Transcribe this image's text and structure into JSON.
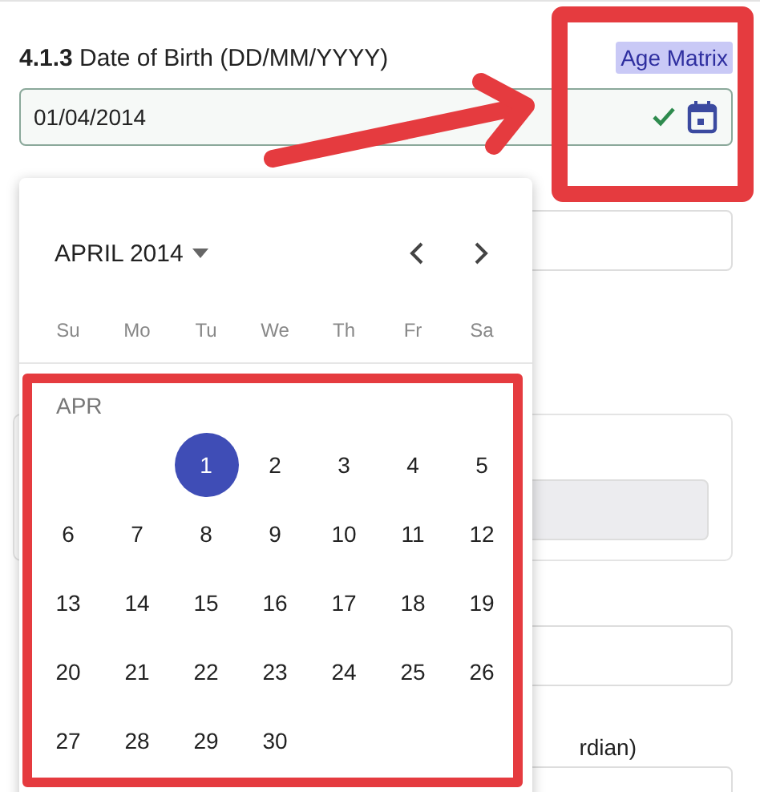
{
  "field_label": {
    "number": "4.1.3",
    "text": "Date of Birth (DD/MM/YYYY)"
  },
  "badge": "Age Matrix",
  "date_field": {
    "value": "01/04/2014",
    "valid": true
  },
  "background_label": "rdian)",
  "calendar": {
    "title": "APRIL 2014",
    "weekdays": [
      "Su",
      "Mo",
      "Tu",
      "We",
      "Th",
      "Fr",
      "Sa"
    ],
    "month_label": "APR",
    "weeks": [
      [
        {
          "kind": "blank"
        },
        {
          "kind": "blank"
        },
        {
          "kind": "day",
          "day": "1",
          "selected": true
        },
        {
          "day": "2",
          "selected": false
        },
        {
          "day": "3",
          "selected": false
        },
        {
          "day": "4",
          "selected": false
        },
        {
          "day": "5",
          "selected": false
        }
      ],
      [
        {
          "day": "6",
          "selected": false
        },
        {
          "day": "7",
          "selected": false
        },
        {
          "day": "8",
          "selected": false
        },
        {
          "day": "9",
          "selected": false
        },
        {
          "day": "10",
          "selected": false
        },
        {
          "day": "11",
          "selected": false
        },
        {
          "day": "12",
          "selected": false
        }
      ],
      [
        {
          "day": "13",
          "selected": false
        },
        {
          "day": "14",
          "selected": false
        },
        {
          "day": "15",
          "selected": false
        },
        {
          "day": "16",
          "selected": false
        },
        {
          "day": "17",
          "selected": false
        },
        {
          "day": "18",
          "selected": false
        },
        {
          "day": "19",
          "selected": false
        }
      ],
      [
        {
          "day": "20",
          "selected": false
        },
        {
          "day": "21",
          "selected": false
        },
        {
          "day": "22",
          "selected": false
        },
        {
          "day": "23",
          "selected": false
        },
        {
          "day": "24",
          "selected": false
        },
        {
          "day": "25",
          "selected": false
        },
        {
          "day": "26",
          "selected": false
        }
      ],
      [
        {
          "day": "27",
          "selected": false
        },
        {
          "day": "28",
          "selected": false
        },
        {
          "day": "29",
          "selected": false
        },
        {
          "day": "30",
          "selected": false
        }
      ]
    ]
  }
}
